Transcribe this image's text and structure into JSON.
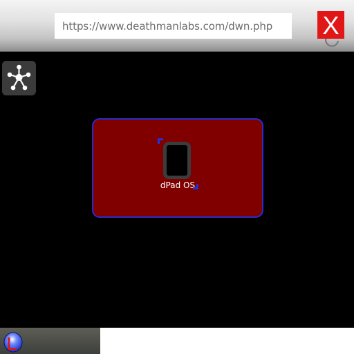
{
  "browser": {
    "url": "https://www.deathmanlabs.com/dwn.php",
    "reload_icon": "reload-icon",
    "close_icon": "close-x-icon",
    "close_label": "X"
  },
  "desktop": {
    "network_icon": "network-hub-icon",
    "app": {
      "label": "dPad OS",
      "icon": "tablet-device-icon"
    }
  },
  "taskbar": {
    "start_icon": "start-orb-icon"
  },
  "colors": {
    "background": "#000000",
    "close_button": "#e11717",
    "panel": "#800000",
    "panel_border": "#2b2bd0",
    "selection": "#2233dd"
  }
}
